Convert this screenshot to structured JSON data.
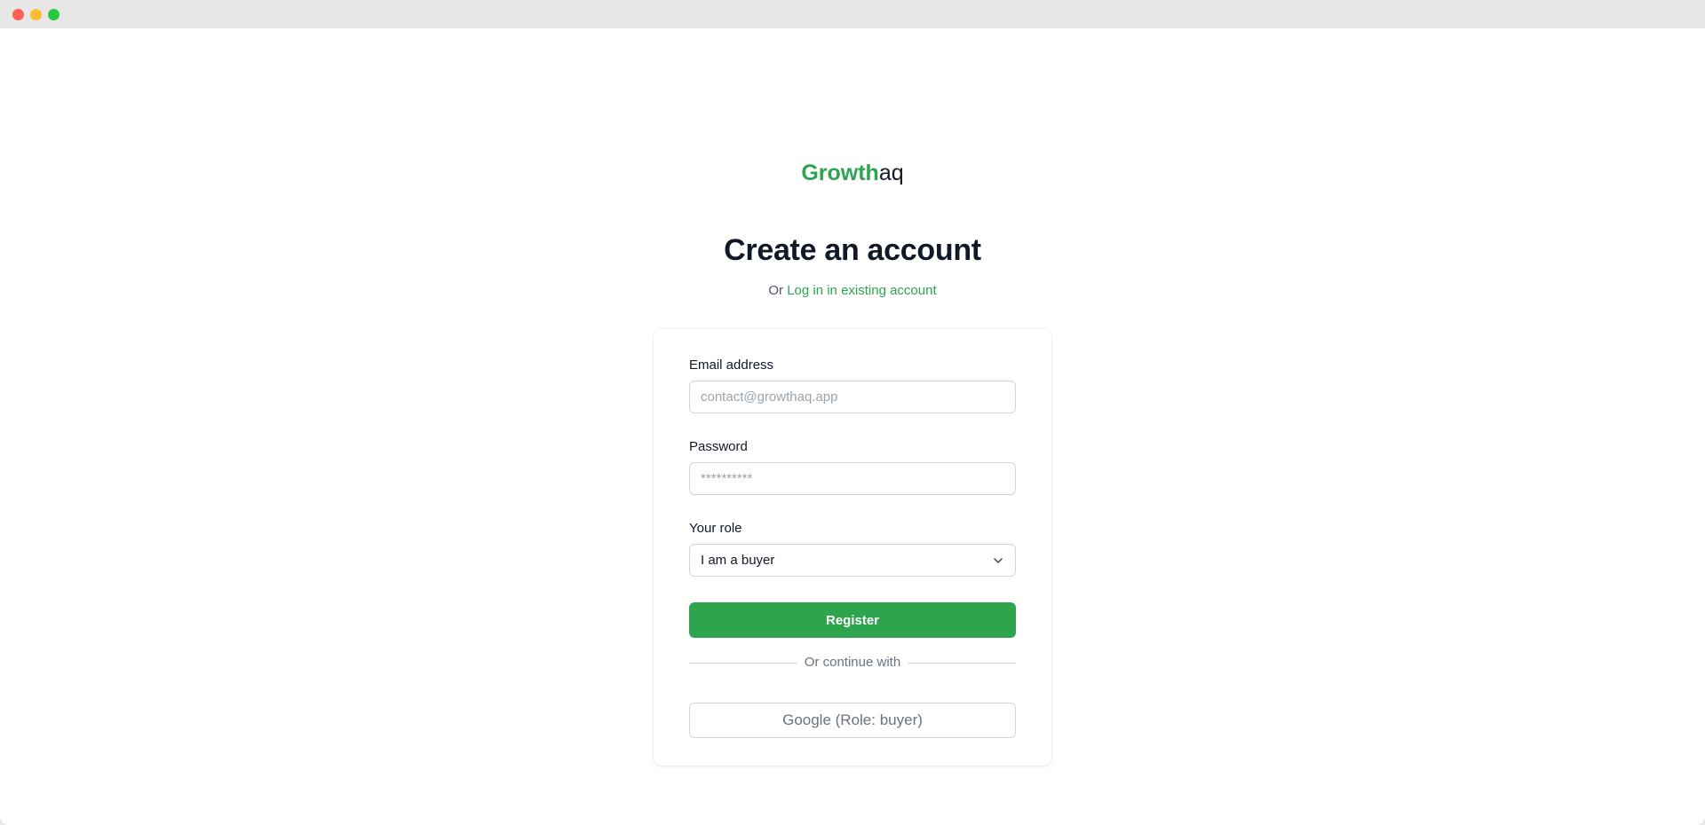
{
  "brand": {
    "strong": "Growth",
    "rest": "aq"
  },
  "heading": "Create an account",
  "subline": {
    "prefix": "Or",
    "link": "Log in in existing account"
  },
  "form": {
    "email": {
      "label": "Email address",
      "placeholder": "contact@growthaq.app",
      "value": ""
    },
    "password": {
      "label": "Password",
      "placeholder": "**********",
      "value": ""
    },
    "role": {
      "label": "Your role",
      "selected": "I am a buyer"
    },
    "register_label": "Register",
    "divider_text": "Or continue with",
    "google_label": "Google (Role: buyer)"
  },
  "colors": {
    "accent": "#2ea44f",
    "text": "#111827",
    "muted": "#6b7280",
    "border": "#d1d5db"
  },
  "icons": {
    "window_controls": [
      "close-dot",
      "minimize-dot",
      "zoom-dot"
    ],
    "select": "chevron-down-icon"
  }
}
